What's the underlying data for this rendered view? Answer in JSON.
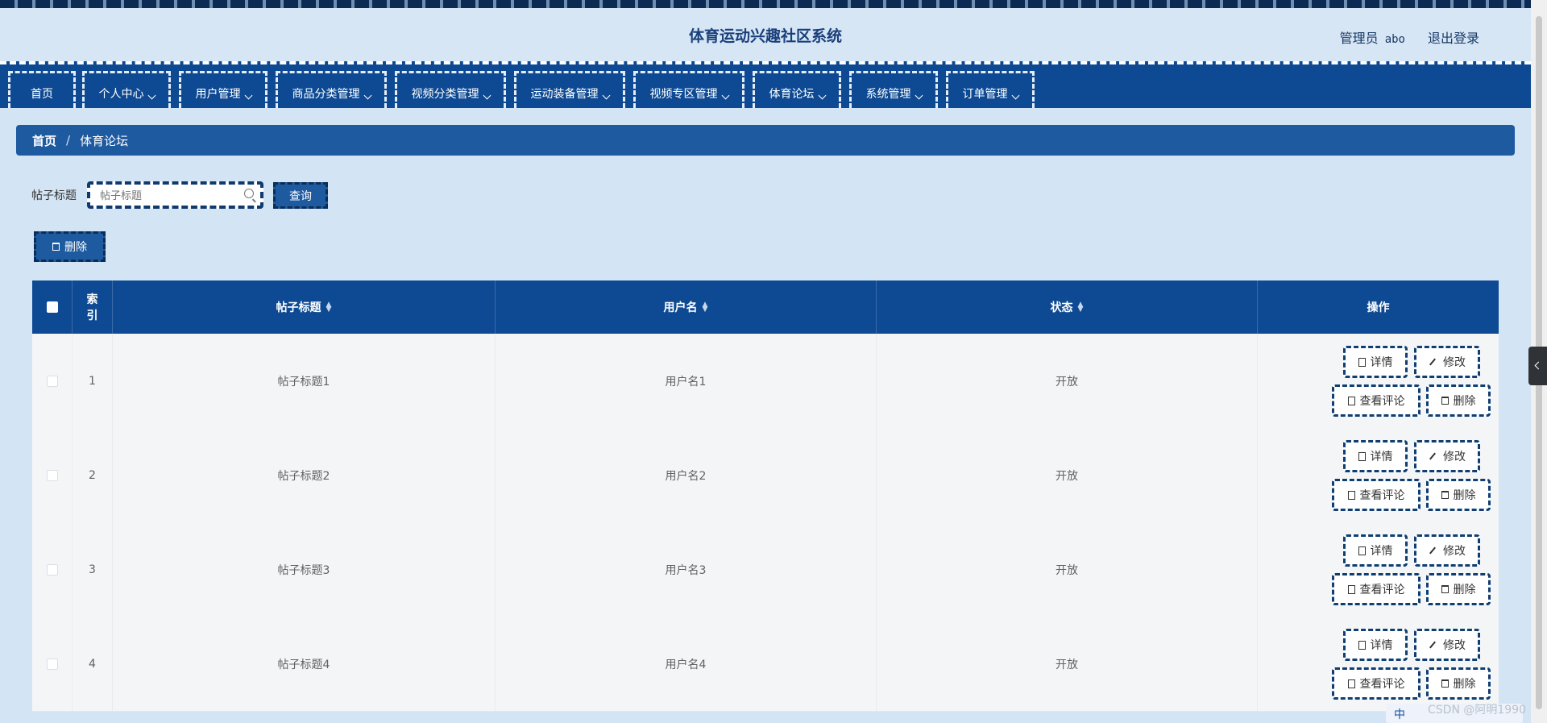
{
  "app": {
    "title": "体育运动兴趣社区系统"
  },
  "user": {
    "role": "管理员",
    "name": "abo",
    "logout": "退出登录"
  },
  "nav": [
    {
      "label": "首页",
      "dropdown": false
    },
    {
      "label": "个人中心",
      "dropdown": true
    },
    {
      "label": "用户管理",
      "dropdown": true
    },
    {
      "label": "商品分类管理",
      "dropdown": true
    },
    {
      "label": "视频分类管理",
      "dropdown": true
    },
    {
      "label": "运动装备管理",
      "dropdown": true
    },
    {
      "label": "视频专区管理",
      "dropdown": true
    },
    {
      "label": "体育论坛",
      "dropdown": true
    },
    {
      "label": "系统管理",
      "dropdown": true
    },
    {
      "label": "订单管理",
      "dropdown": true
    }
  ],
  "breadcrumb": {
    "home": "首页",
    "separator": "/",
    "current": "体育论坛"
  },
  "search": {
    "label": "帖子标题",
    "placeholder": "帖子标题",
    "button": "查询"
  },
  "toolbar": {
    "delete": "删除"
  },
  "table": {
    "headers": {
      "index": "索引",
      "title": "帖子标题",
      "username": "用户名",
      "status": "状态",
      "actions": "操作"
    },
    "rows": [
      {
        "index": "1",
        "title": "帖子标题1",
        "username": "用户名1",
        "status": "开放"
      },
      {
        "index": "2",
        "title": "帖子标题2",
        "username": "用户名2",
        "status": "开放"
      },
      {
        "index": "3",
        "title": "帖子标题3",
        "username": "用户名3",
        "status": "开放"
      },
      {
        "index": "4",
        "title": "帖子标题4",
        "username": "用户名4",
        "status": "开放"
      }
    ],
    "actions": {
      "detail": "详情",
      "edit": "修改",
      "comments": "查看评论",
      "delete": "删除"
    }
  },
  "watermark": "CSDN @阿明1990",
  "ime": "中",
  "colors": {
    "primary": "#0e4a93",
    "accent": "#1e5a9f",
    "background": "#d3e4f4"
  }
}
